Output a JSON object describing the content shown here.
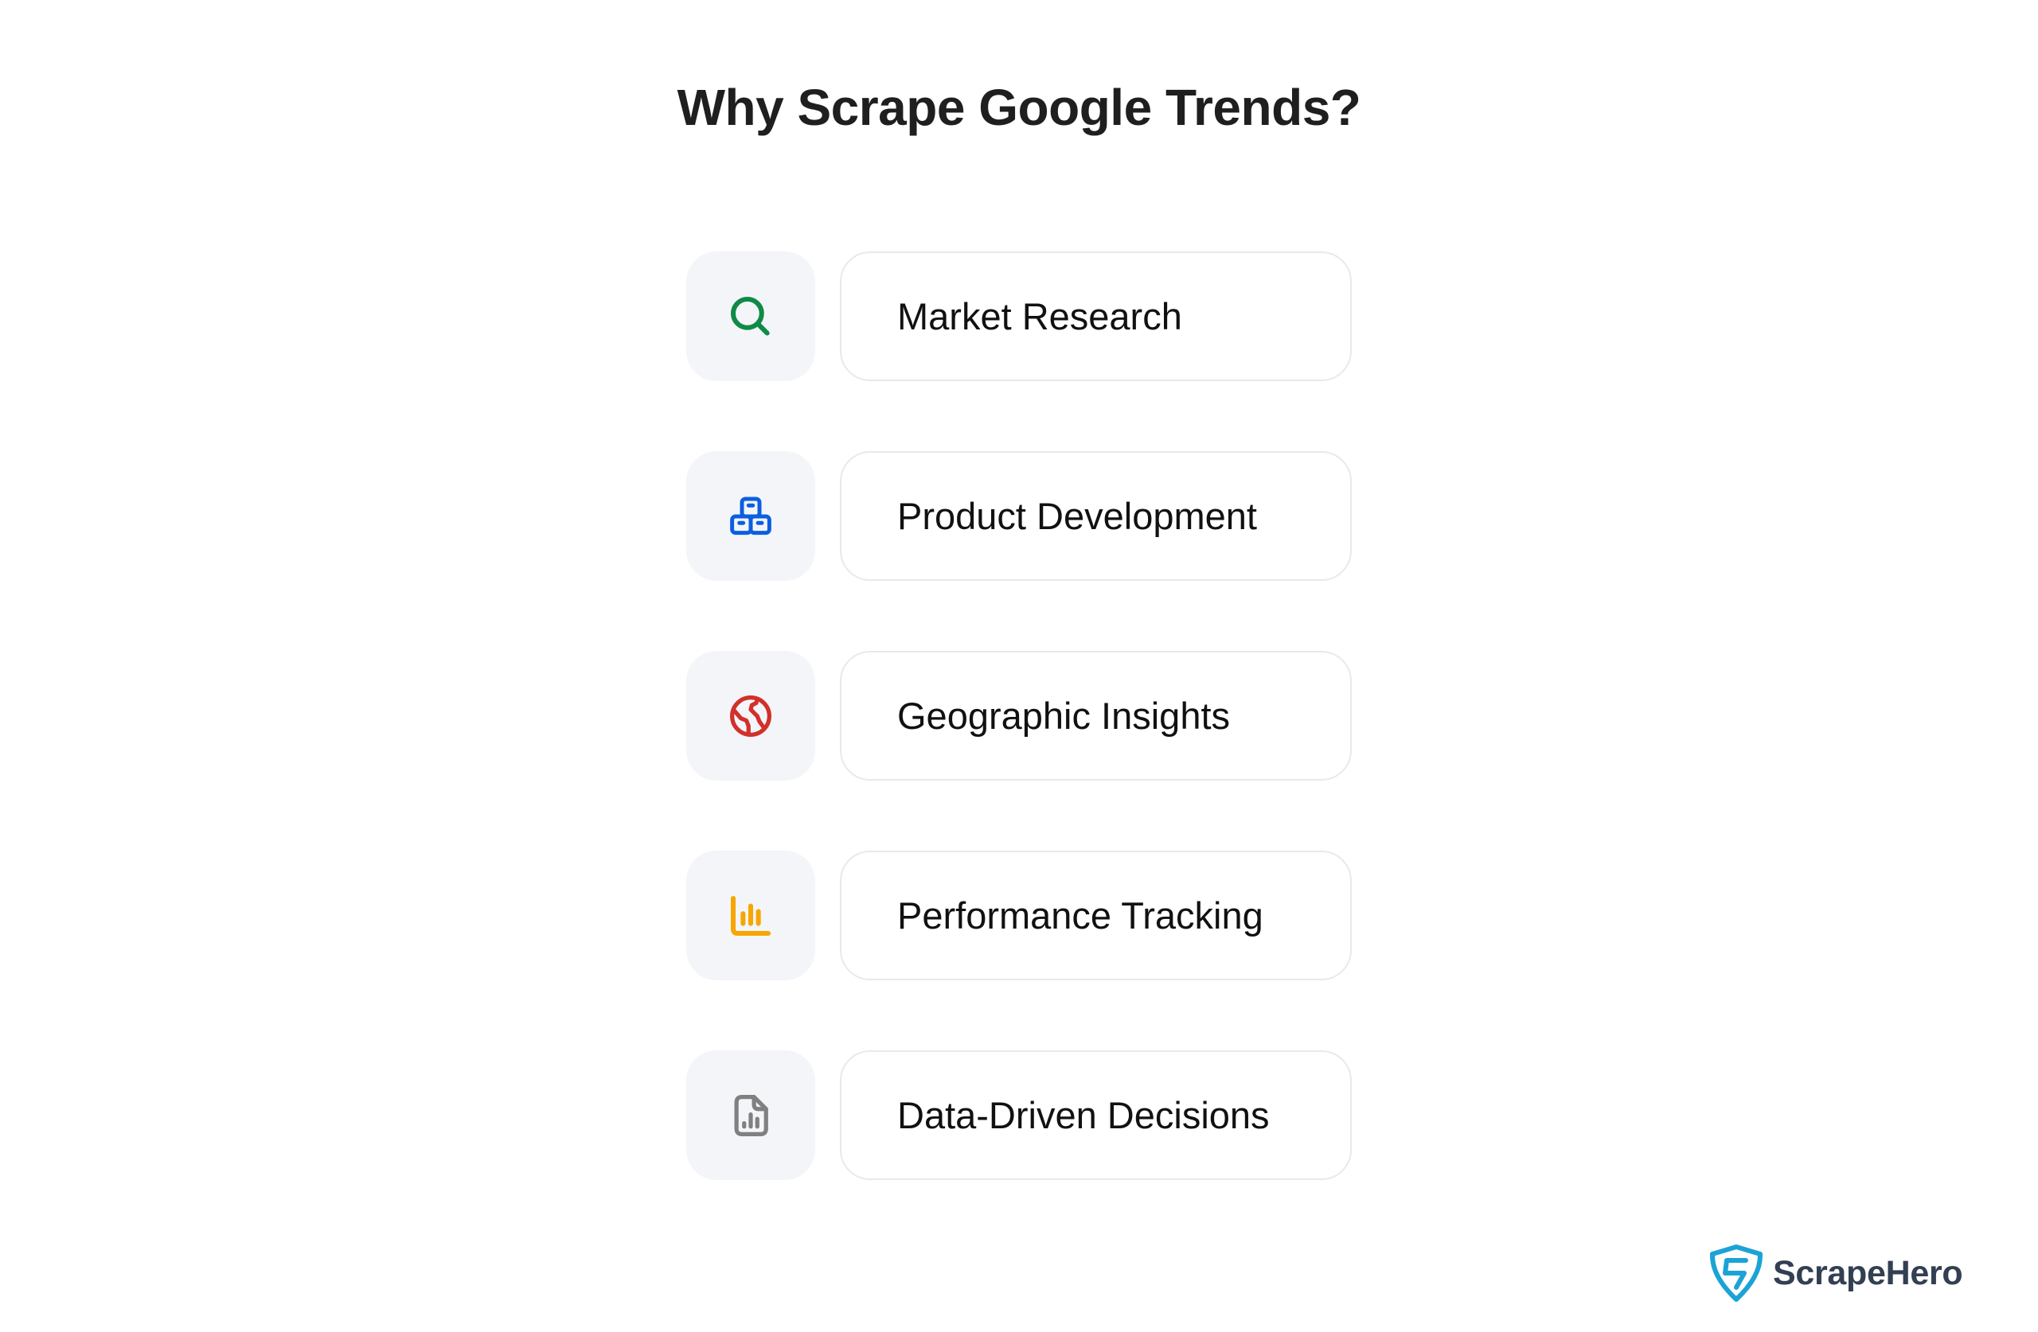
{
  "title": "Why Scrape Google Trends?",
  "items": [
    {
      "label": "Market Research",
      "icon": "search-icon",
      "icon_color": "#0f8a47"
    },
    {
      "label": "Product Development",
      "icon": "boxes-icon",
      "icon_color": "#0b5fe0"
    },
    {
      "label": "Geographic Insights",
      "icon": "globe-icon",
      "icon_color": "#d2302a"
    },
    {
      "label": "Performance Tracking",
      "icon": "bar-chart-icon",
      "icon_color": "#f7a600"
    },
    {
      "label": "Data-Driven Decisions",
      "icon": "document-chart-icon",
      "icon_color": "#808080"
    }
  ],
  "logo": {
    "text": "ScrapeHero",
    "icon": "shield-s-icon",
    "icon_color": "#1ba3d6",
    "text_color": "#333f52"
  }
}
